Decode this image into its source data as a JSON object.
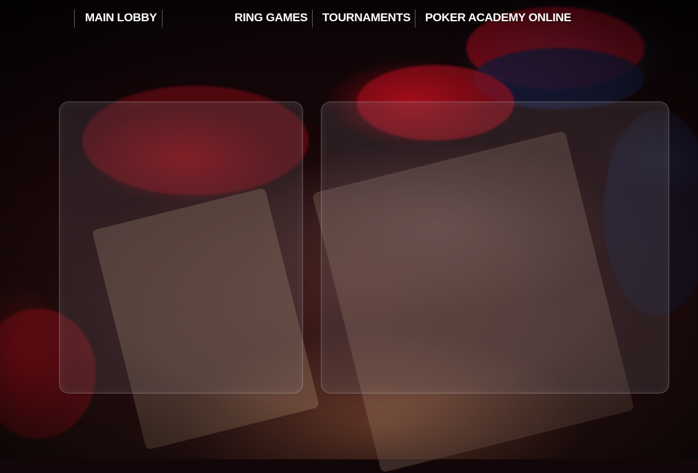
{
  "nav": {
    "main_lobby": "MAIN LOBBY",
    "ring_games": "RING GAMES",
    "tournaments": "TOURNAMENTS",
    "poker_academy_online": "POKER ACADEMY ONLINE"
  },
  "icons": {
    "background": "poker-chips-and-cards-image"
  },
  "colors": {
    "nav_text": "#ffffff",
    "chip_red": "#b0101c",
    "chip_navy": "#1c1f3a"
  }
}
